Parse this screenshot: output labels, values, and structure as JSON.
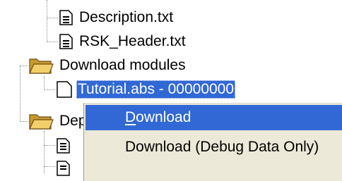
{
  "tree": {
    "file1": {
      "label": "Description.txt",
      "icon": "text-file-icon"
    },
    "file2": {
      "label": "RSK_Header.txt",
      "icon": "text-file-icon"
    },
    "folder1": {
      "label": "Download modules",
      "icon": "folder-open-icon"
    },
    "module": {
      "label": "Tutorial.abs - 00000000",
      "icon": "blank-file-icon",
      "selected": true
    },
    "folder2": {
      "label": "Dep",
      "icon": "folder-open-icon"
    },
    "dep_file1": {
      "icon": "text-file-icon"
    },
    "dep_file2": {
      "icon": "text-file-icon"
    }
  },
  "context_menu": {
    "item1": {
      "label": "Download",
      "mnemonic": "D",
      "highlighted": true
    },
    "item2": {
      "label": "Download (Debug Data Only)"
    }
  },
  "colors": {
    "selection": "#3168d5",
    "menu_bg": "#ece9d8",
    "folder": "#e0b64a"
  }
}
